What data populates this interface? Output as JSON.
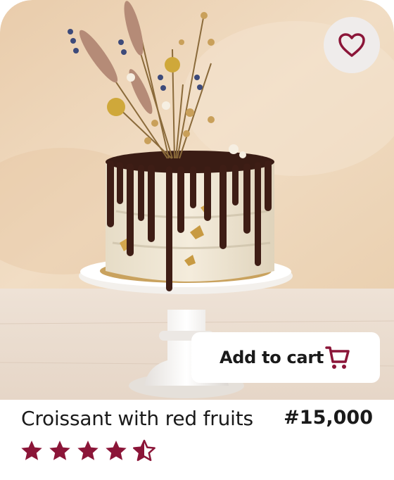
{
  "product": {
    "title": "Croissant with red fruits",
    "price": "#15,000",
    "rating": 4.5,
    "rating_max": 5
  },
  "actions": {
    "add_to_cart_label": "Add to cart"
  },
  "icons": {
    "favorite": "heart-icon",
    "cart": "cart-icon",
    "star": "star-icon"
  },
  "colors": {
    "accent": "#8b1538",
    "fav_button_bg": "#efeceb",
    "text": "#1a1a1a"
  }
}
